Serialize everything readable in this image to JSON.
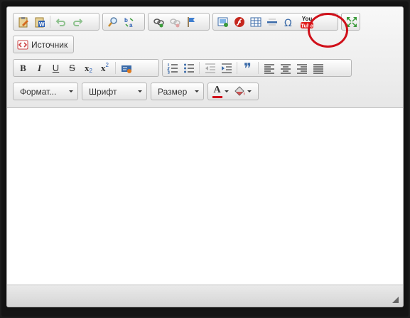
{
  "toolbar": {
    "source_label": "Источник",
    "format_label": "Формат...",
    "font_label": "Шрифт",
    "size_label": "Размер",
    "youtube_text_top": "You",
    "youtube_text_bottom": "Tube",
    "bold_glyph": "B",
    "italic_glyph": "I",
    "underline_glyph": "U",
    "strike_glyph": "S",
    "subscript_glyph": "x",
    "subscript_mark": "2",
    "superscript_glyph": "x",
    "superscript_mark": "2",
    "font_color_glyph": "A",
    "quote_glyph": "❞"
  },
  "colors": {
    "highlight_circle": "#d0101a",
    "youtube_red": "#e3221e"
  }
}
